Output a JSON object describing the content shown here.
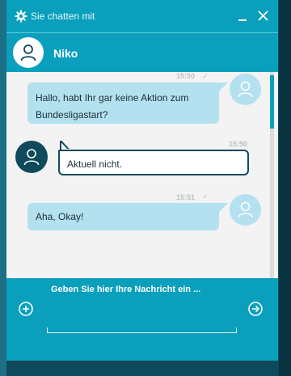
{
  "header": {
    "title": "Sie chatten mit",
    "icons": {
      "settings": "gear-icon",
      "minimize": "minimize-icon",
      "close": "close-icon"
    }
  },
  "agent": {
    "name": "Niko",
    "avatar_icon": "user-icon"
  },
  "messages": [
    {
      "sender": "user",
      "text": "Hallo, habt Ihr gar keine Aktion zum Bundesligastart?",
      "time": "15:50",
      "status": "read-check"
    },
    {
      "sender": "agent",
      "text": "Aktuell nicht.",
      "time": "15:50"
    },
    {
      "sender": "user",
      "text": "Aha, Okay!",
      "time": "15:51",
      "status": "read-check"
    }
  ],
  "input": {
    "placeholder": "Geben Sie hier Ihre Nachricht ein ...",
    "icons": {
      "attach": "plus-circle-icon",
      "send": "arrow-right-circle-icon"
    }
  },
  "colors": {
    "accent": "#0aa0bd",
    "dark": "#0f4a5c",
    "user_bubble": "#b4e1ef",
    "message_background": "#f3f3f3"
  }
}
